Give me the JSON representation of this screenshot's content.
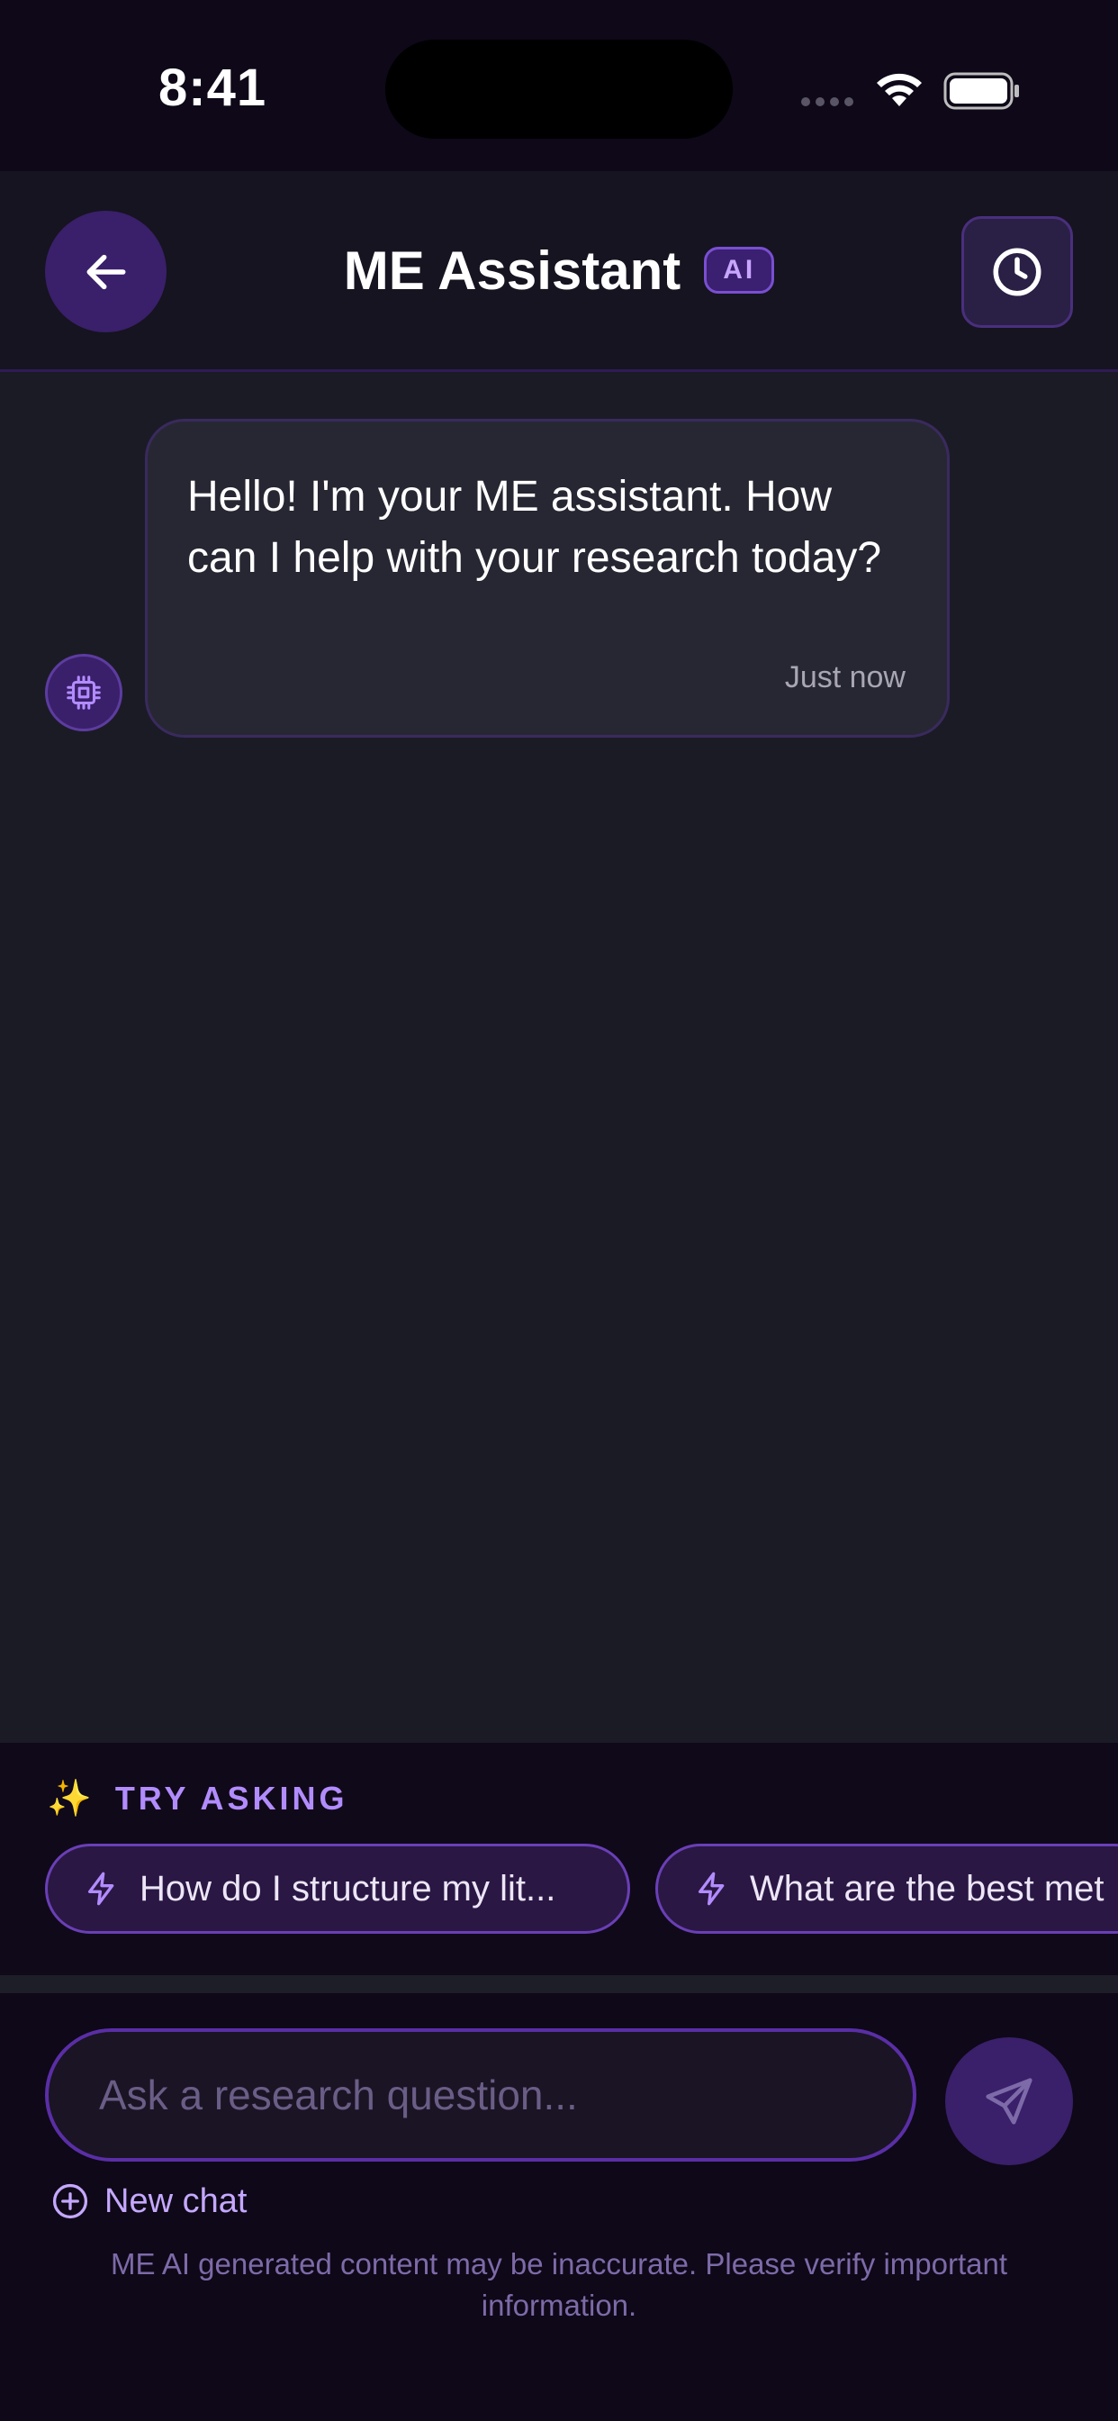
{
  "status_bar": {
    "time": "8:41"
  },
  "header": {
    "title": "ME Assistant",
    "badge": "AI",
    "back_icon": "arrow-left-icon",
    "history_icon": "clock-icon"
  },
  "messages": [
    {
      "sender": "assistant",
      "text": "Hello! I'm your ME assistant. How can I help with your research today?",
      "time": "Just now",
      "avatar_icon": "cpu-chip-icon"
    }
  ],
  "suggestions": {
    "heading": "TRY ASKING",
    "heading_icon": "sparkles-icon",
    "chips": [
      {
        "label": "How do I structure my lit...",
        "icon": "lightning-icon"
      },
      {
        "label": "What are the best met",
        "icon": "lightning-icon"
      }
    ]
  },
  "composer": {
    "placeholder": "Ask a research question...",
    "send_icon": "send-icon",
    "new_chat_label": "New chat",
    "new_chat_icon": "plus-circle-icon",
    "disclaimer": "ME AI generated content may be inaccurate. Please verify important information."
  },
  "colors": {
    "accent": "#7a4fd1",
    "accent_light": "#b28cff",
    "background": "#0e0818",
    "chat_background": "#1b1b26"
  }
}
